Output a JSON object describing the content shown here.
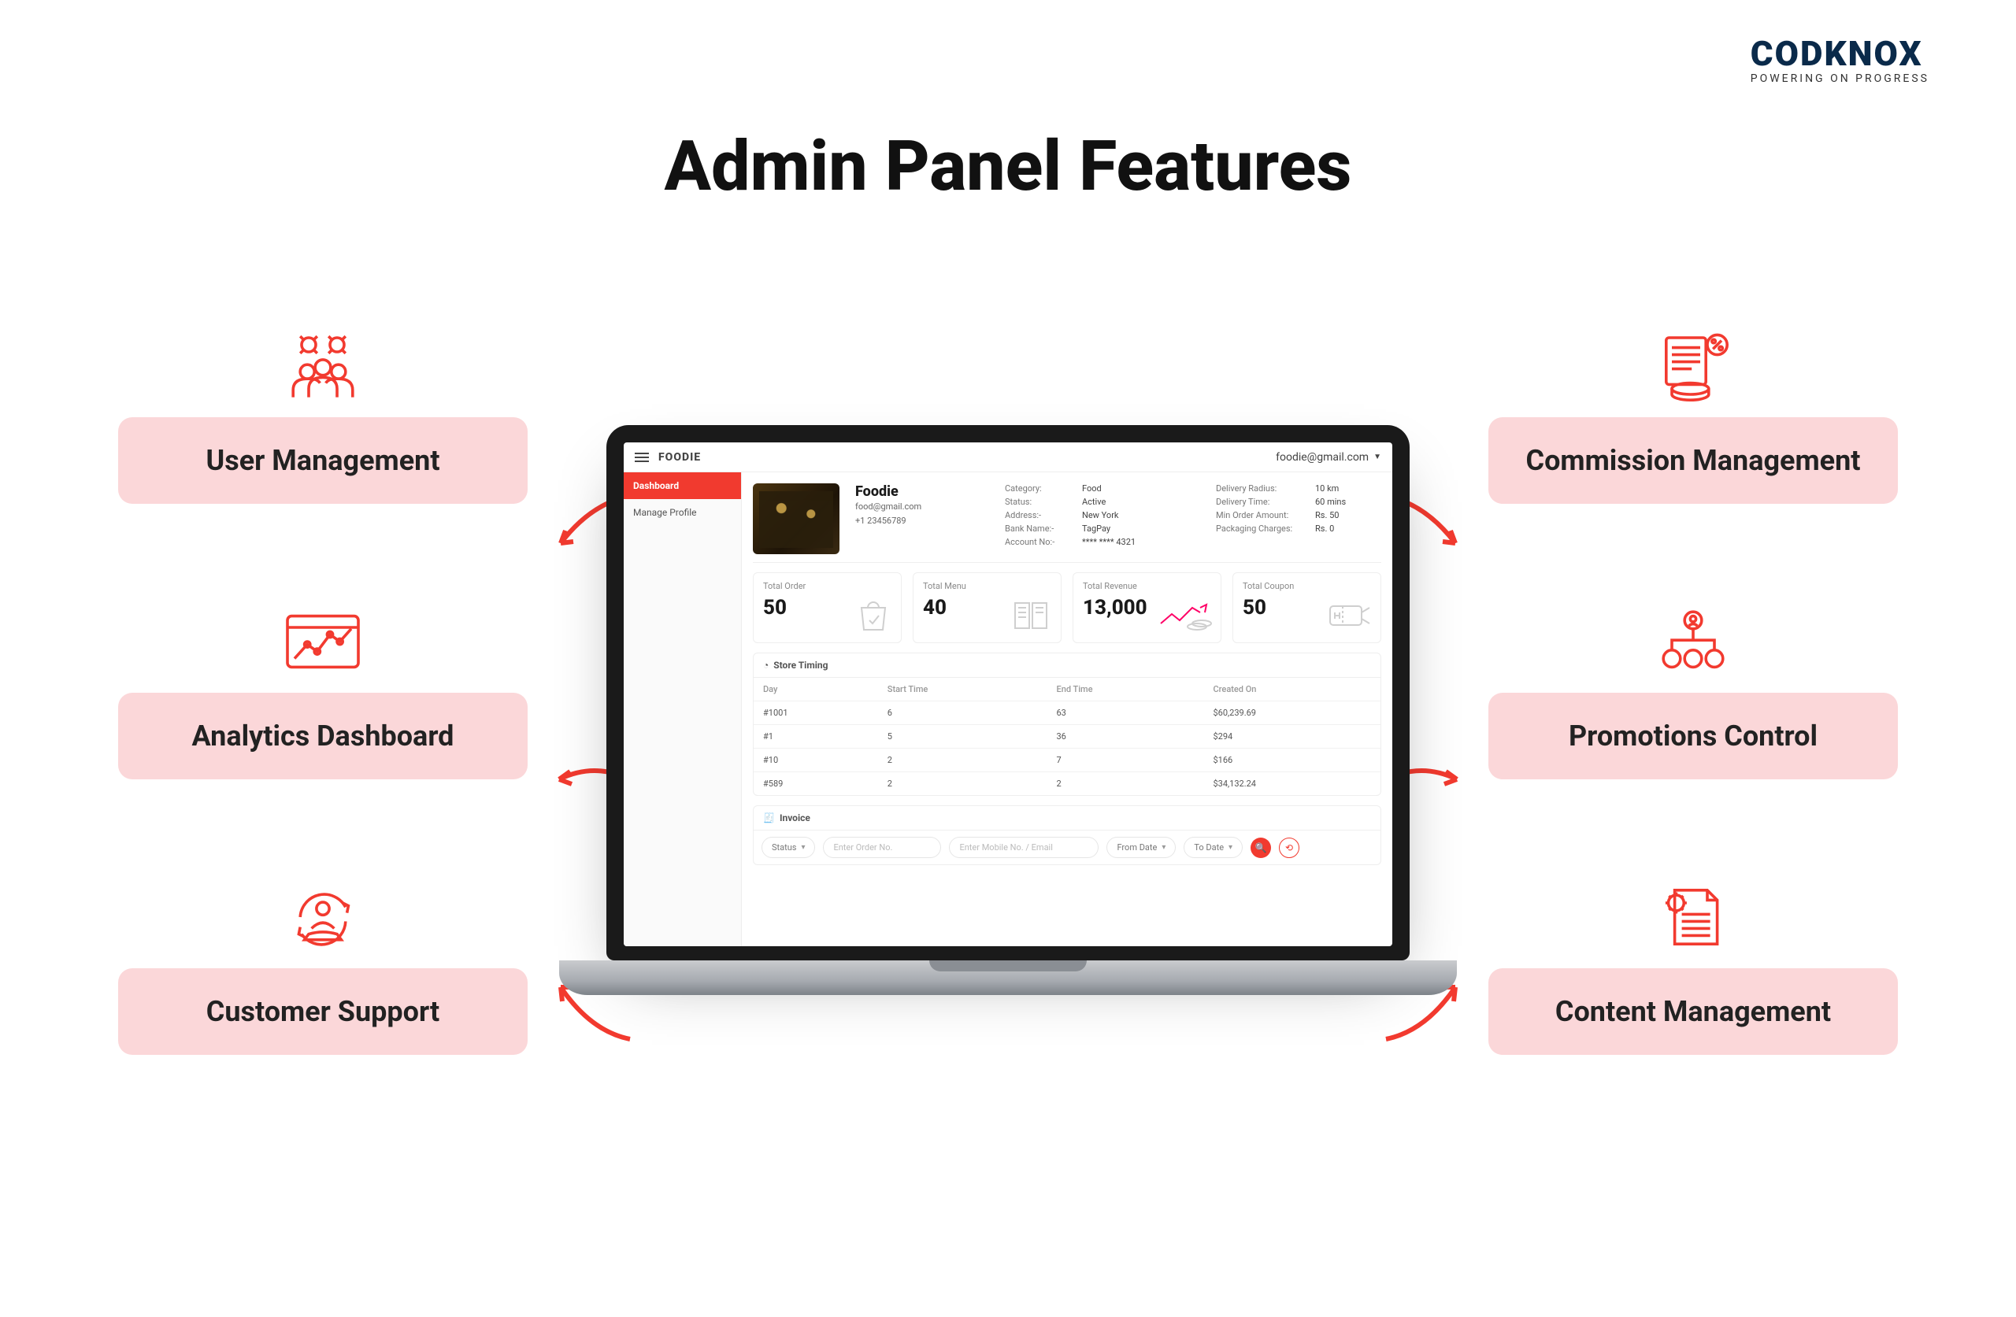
{
  "brand": {
    "name": "CODKNOX",
    "tagline": "POWERING ON PROGRESS"
  },
  "title": "Admin Panel Features",
  "features_left": [
    {
      "label": "User Management"
    },
    {
      "label": "Analytics Dashboard"
    },
    {
      "label": "Customer Support"
    }
  ],
  "features_right": [
    {
      "label": "Commission Management"
    },
    {
      "label": "Promotions Control"
    },
    {
      "label": "Content Management"
    }
  ],
  "screen": {
    "app_name": "FOODIE",
    "user_email": "foodie@gmail.com",
    "sidebar": {
      "items": [
        {
          "label": "Dashboard",
          "active": true
        },
        {
          "label": "Manage Profile",
          "active": false
        }
      ]
    },
    "profile": {
      "name": "Foodie",
      "email": "food@gmail.com",
      "phone": "+1 23456789",
      "info_a": [
        {
          "k": "Category:",
          "v": "Food"
        },
        {
          "k": "Status:",
          "v": "Active"
        },
        {
          "k": "Address:-",
          "v": "New York"
        },
        {
          "k": "Bank Name:-",
          "v": "TagPay"
        },
        {
          "k": "Account No:-",
          "v": "**** **** 4321"
        }
      ],
      "info_b": [
        {
          "k": "Delivery Radius:",
          "v": "10 km"
        },
        {
          "k": "Delivery Time:",
          "v": "60 mins"
        },
        {
          "k": "Min Order Amount:",
          "v": "Rs. 50"
        },
        {
          "k": "Packaging Charges:",
          "v": "Rs. 0"
        }
      ]
    },
    "stats": [
      {
        "label": "Total Order",
        "value": "50"
      },
      {
        "label": "Total Menu",
        "value": "40"
      },
      {
        "label": "Total Revenue",
        "value": "13,000"
      },
      {
        "label": "Total Coupon",
        "value": "50"
      }
    ],
    "store_timing": {
      "title": "Store Timing",
      "columns": [
        "Day",
        "Start Time",
        "End Time",
        "Created On"
      ],
      "rows": [
        {
          "c0": "#1001",
          "c1": "6",
          "c2": "63",
          "c3": "$60,239.69"
        },
        {
          "c0": "#1",
          "c1": "5",
          "c2": "36",
          "c3": "$294"
        },
        {
          "c0": "#10",
          "c1": "2",
          "c2": "7",
          "c3": "$166"
        },
        {
          "c0": "#589",
          "c1": "2",
          "c2": "2",
          "c3": "$34,132.24"
        }
      ]
    },
    "invoice": {
      "title": "Invoice",
      "filters": {
        "status_label": "Status",
        "order_no_placeholder": "Enter Order No.",
        "contact_placeholder": "Enter Mobile No. / Email",
        "from_label": "From Date",
        "to_label": "To Date"
      }
    }
  }
}
